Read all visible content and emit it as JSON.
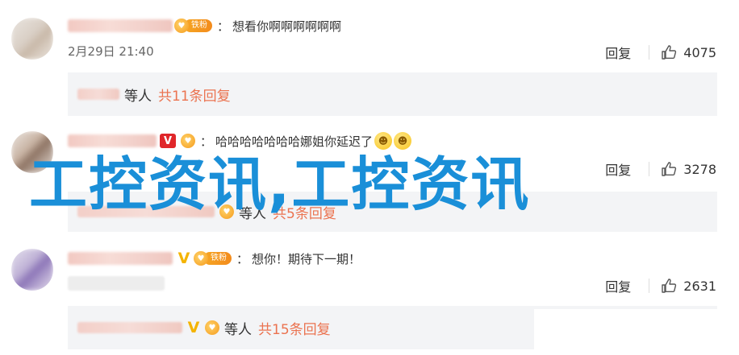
{
  "comments": [
    {
      "fan_label": "铁粉",
      "separator": "：",
      "text": "想看你啊啊啊啊啊啊",
      "time": "2月29日 21:40",
      "reply_label": "回复",
      "likes": "4075",
      "sub": {
        "who": "等人",
        "more": "共11条回复"
      }
    },
    {
      "verified": "V",
      "separator": "：",
      "text": "哈哈哈哈哈哈哈娜姐你延迟了",
      "reply_label": "回复",
      "likes": "3278",
      "sub": {
        "who": "等人",
        "more": "共5条回复"
      }
    },
    {
      "verified": "V",
      "fan_label": "铁粉",
      "separator": "：",
      "text": "想你！期待下一期！",
      "reply_label": "回复",
      "likes": "2631",
      "sub": {
        "verified": "V",
        "who": "等人",
        "more": "共15条回复"
      }
    }
  ],
  "overlay_text": "工控资讯,工控资讯",
  "colors": {
    "accent": "#eb7350",
    "overlay": "#1a8fd8",
    "verified_red": "#e0262a",
    "verified_gold": "#f4b400"
  }
}
